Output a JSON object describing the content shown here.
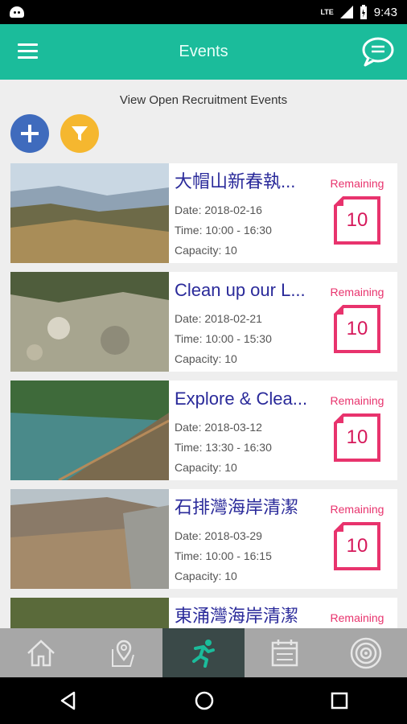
{
  "status_bar": {
    "time": "9:43",
    "network": "LTE"
  },
  "app_bar": {
    "title": "Events",
    "menu_icon": "menu-icon",
    "chat_icon": "chat-bubble-icon"
  },
  "subtitle": "View Open Recruitment Events",
  "colors": {
    "primary": "#1bbc9b",
    "add_button": "#3f6bbd",
    "filter_button": "#f5b72f",
    "remaining": "#e8336d",
    "event_title": "#2a2a9a"
  },
  "events": [
    {
      "name": "大帽山新春執...",
      "date": "Date: 2018-02-16",
      "time": "Time: 10:00 - 16:30",
      "capacity": "Capacity: 10",
      "remaining_label": "Remaining",
      "remaining": "10"
    },
    {
      "name": "Clean up our L...",
      "date": "Date: 2018-02-21",
      "time": "Time: 10:00 - 15:30",
      "capacity": "Capacity: 10",
      "remaining_label": "Remaining",
      "remaining": "10"
    },
    {
      "name": "Explore & Clea...",
      "date": "Date: 2018-03-12",
      "time": "Time: 13:30 - 16:30",
      "capacity": "Capacity: 10",
      "remaining_label": "Remaining",
      "remaining": "10"
    },
    {
      "name": "石排灣海岸清潔",
      "date": "Date: 2018-03-29",
      "time": "Time: 10:00 - 16:15",
      "capacity": "Capacity: 10",
      "remaining_label": "Remaining",
      "remaining": "10"
    },
    {
      "name": "東涌灣海岸清潔",
      "date": "",
      "time": "",
      "capacity": "",
      "remaining_label": "Remaining",
      "remaining": ""
    }
  ],
  "bottom_nav": [
    {
      "icon": "home-icon",
      "active": false
    },
    {
      "icon": "map-pin-icon",
      "active": false
    },
    {
      "icon": "runner-icon",
      "active": true
    },
    {
      "icon": "calendar-icon",
      "active": false
    },
    {
      "icon": "target-icon",
      "active": false
    }
  ]
}
